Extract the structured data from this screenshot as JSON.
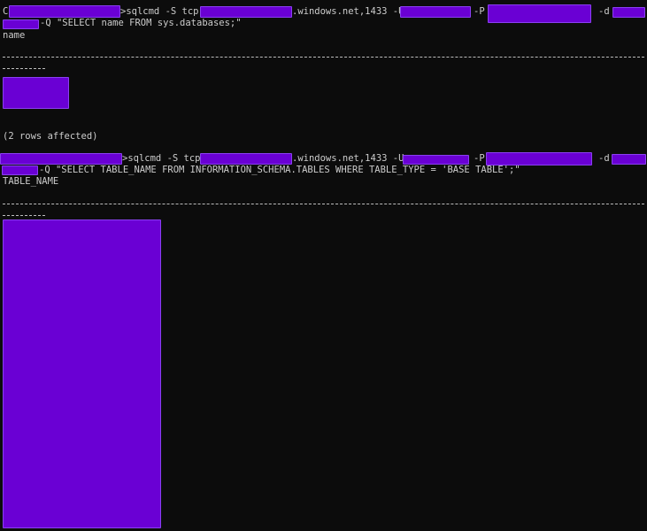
{
  "terminal": {
    "cmd1": {
      "prompt_prefix": "C",
      "sqlcmd": ">sqlcmd -S tcp:",
      "domain": ".windows.net,1433 -U",
      "pass_flag": "-P",
      "db_flag": "-d",
      "query": "-Q \"SELECT name FROM sys.databases;\""
    },
    "result1": {
      "column": "name",
      "rows_affected": "(2 rows affected)"
    },
    "cmd2": {
      "sqlcmd": ">sqlcmd -S tcp:",
      "domain": ".windows.net,1433 -U",
      "pass_flag": "-P",
      "db_flag": "-d",
      "query": "-Q \"SELECT TABLE_NAME FROM INFORMATION_SCHEMA.TABLES WHERE TABLE_TYPE = 'BASE TABLE';\""
    },
    "result2": {
      "column": "TABLE_NAME"
    },
    "redaction_color": "#6a00d4"
  }
}
